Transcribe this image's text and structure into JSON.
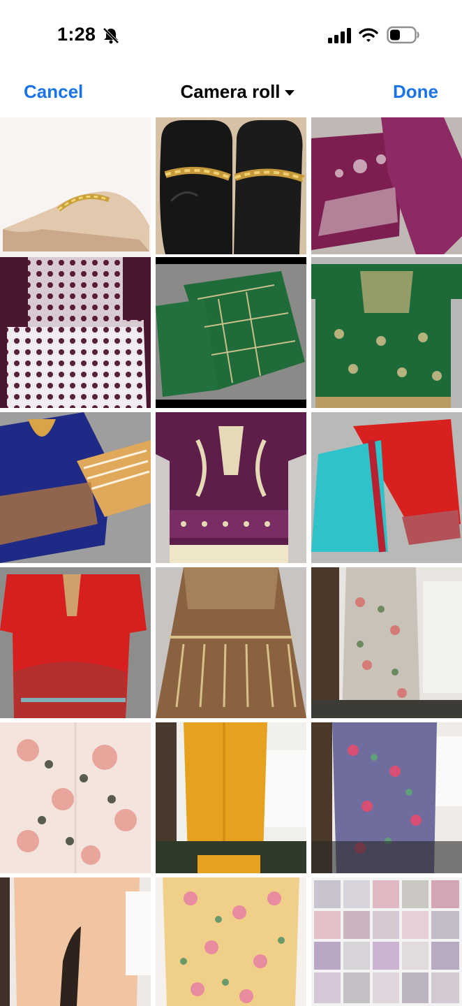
{
  "status_bar": {
    "time": "1:28",
    "icons": [
      "bell-slash-icon",
      "cellular-signal-icon",
      "wifi-icon",
      "battery-icon"
    ]
  },
  "nav": {
    "cancel_label": "Cancel",
    "title": "Camera roll",
    "done_label": "Done"
  },
  "colors": {
    "accent": "#1a73e8",
    "background": "#ffffff"
  },
  "photos": [
    {
      "name": "photo-beige-chain-mule"
    },
    {
      "name": "photo-black-chain-loafers"
    },
    {
      "name": "photo-magenta-embroidered-suit"
    },
    {
      "name": "photo-maroon-white-print-kurta"
    },
    {
      "name": "photo-green-embroidered-dupatta"
    },
    {
      "name": "photo-green-embroidered-kurta"
    },
    {
      "name": "photo-blue-embroidered-suit"
    },
    {
      "name": "photo-purple-printed-kurta"
    },
    {
      "name": "photo-red-teal-suit"
    },
    {
      "name": "photo-red-embroidered-kurta"
    },
    {
      "name": "photo-brown-printed-frock"
    },
    {
      "name": "photo-floral-suit-mirror"
    },
    {
      "name": "photo-pink-floral-shirt"
    },
    {
      "name": "photo-mustard-kurta"
    },
    {
      "name": "photo-lavender-floral-suit"
    },
    {
      "name": "photo-peach-kurta"
    },
    {
      "name": "photo-yellow-floral-kurta"
    },
    {
      "name": "photo-suits-collage"
    }
  ]
}
